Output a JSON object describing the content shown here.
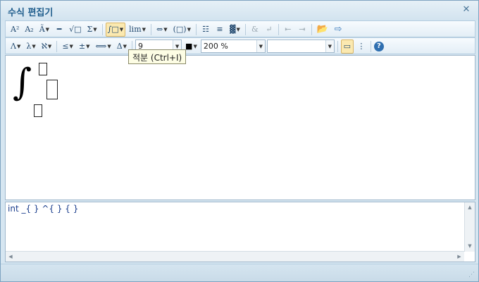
{
  "window": {
    "title": "수식 편집기",
    "close_label": "✕"
  },
  "toolbar1": {
    "items": [
      {
        "glyph": "A²",
        "dd": false
      },
      {
        "glyph": "A₂",
        "dd": false
      },
      {
        "glyph": "Ã",
        "dd": true
      },
      {
        "glyph": "━",
        "dd": false
      },
      {
        "glyph": "√□",
        "dd": false
      },
      {
        "glyph": "Σ",
        "dd": true
      },
      {
        "glyph": "∫□",
        "dd": true,
        "active": true
      },
      {
        "glyph": "lim",
        "dd": true
      },
      {
        "glyph": "⇔",
        "dd": true
      },
      {
        "glyph": "(□)",
        "dd": true
      },
      {
        "glyph": "☷",
        "dd": false
      },
      {
        "glyph": "≡",
        "dd": false
      },
      {
        "glyph": "▓",
        "dd": true
      },
      {
        "glyph": "&",
        "dd": false,
        "dim": true
      },
      {
        "glyph": "↵",
        "dd": false,
        "dim": true
      },
      {
        "glyph": "⇤",
        "dd": false,
        "dim": true
      },
      {
        "glyph": "⇥",
        "dd": false,
        "dim": true
      }
    ],
    "open_icon": "folder-icon",
    "exit_icon": "exit-icon"
  },
  "toolbar2": {
    "items": [
      {
        "glyph": "Λ",
        "dd": true
      },
      {
        "glyph": "λ",
        "dd": true
      },
      {
        "glyph": "ℵ",
        "dd": true
      },
      {
        "glyph": "≤",
        "dd": true
      },
      {
        "glyph": "±",
        "dd": true
      },
      {
        "glyph": "⟺",
        "dd": true
      },
      {
        "glyph": "Δ",
        "dd": true
      }
    ],
    "font_size": "9",
    "color_label": "■",
    "zoom": "200 %",
    "font_name": "",
    "help_label": "?"
  },
  "tooltip": {
    "text": "적분 (Ctrl+I)"
  },
  "equation": {
    "integral_glyph": "∫"
  },
  "source": {
    "text": "int _{ } ^{ } { }"
  },
  "status": {
    "grip": "⋰"
  }
}
